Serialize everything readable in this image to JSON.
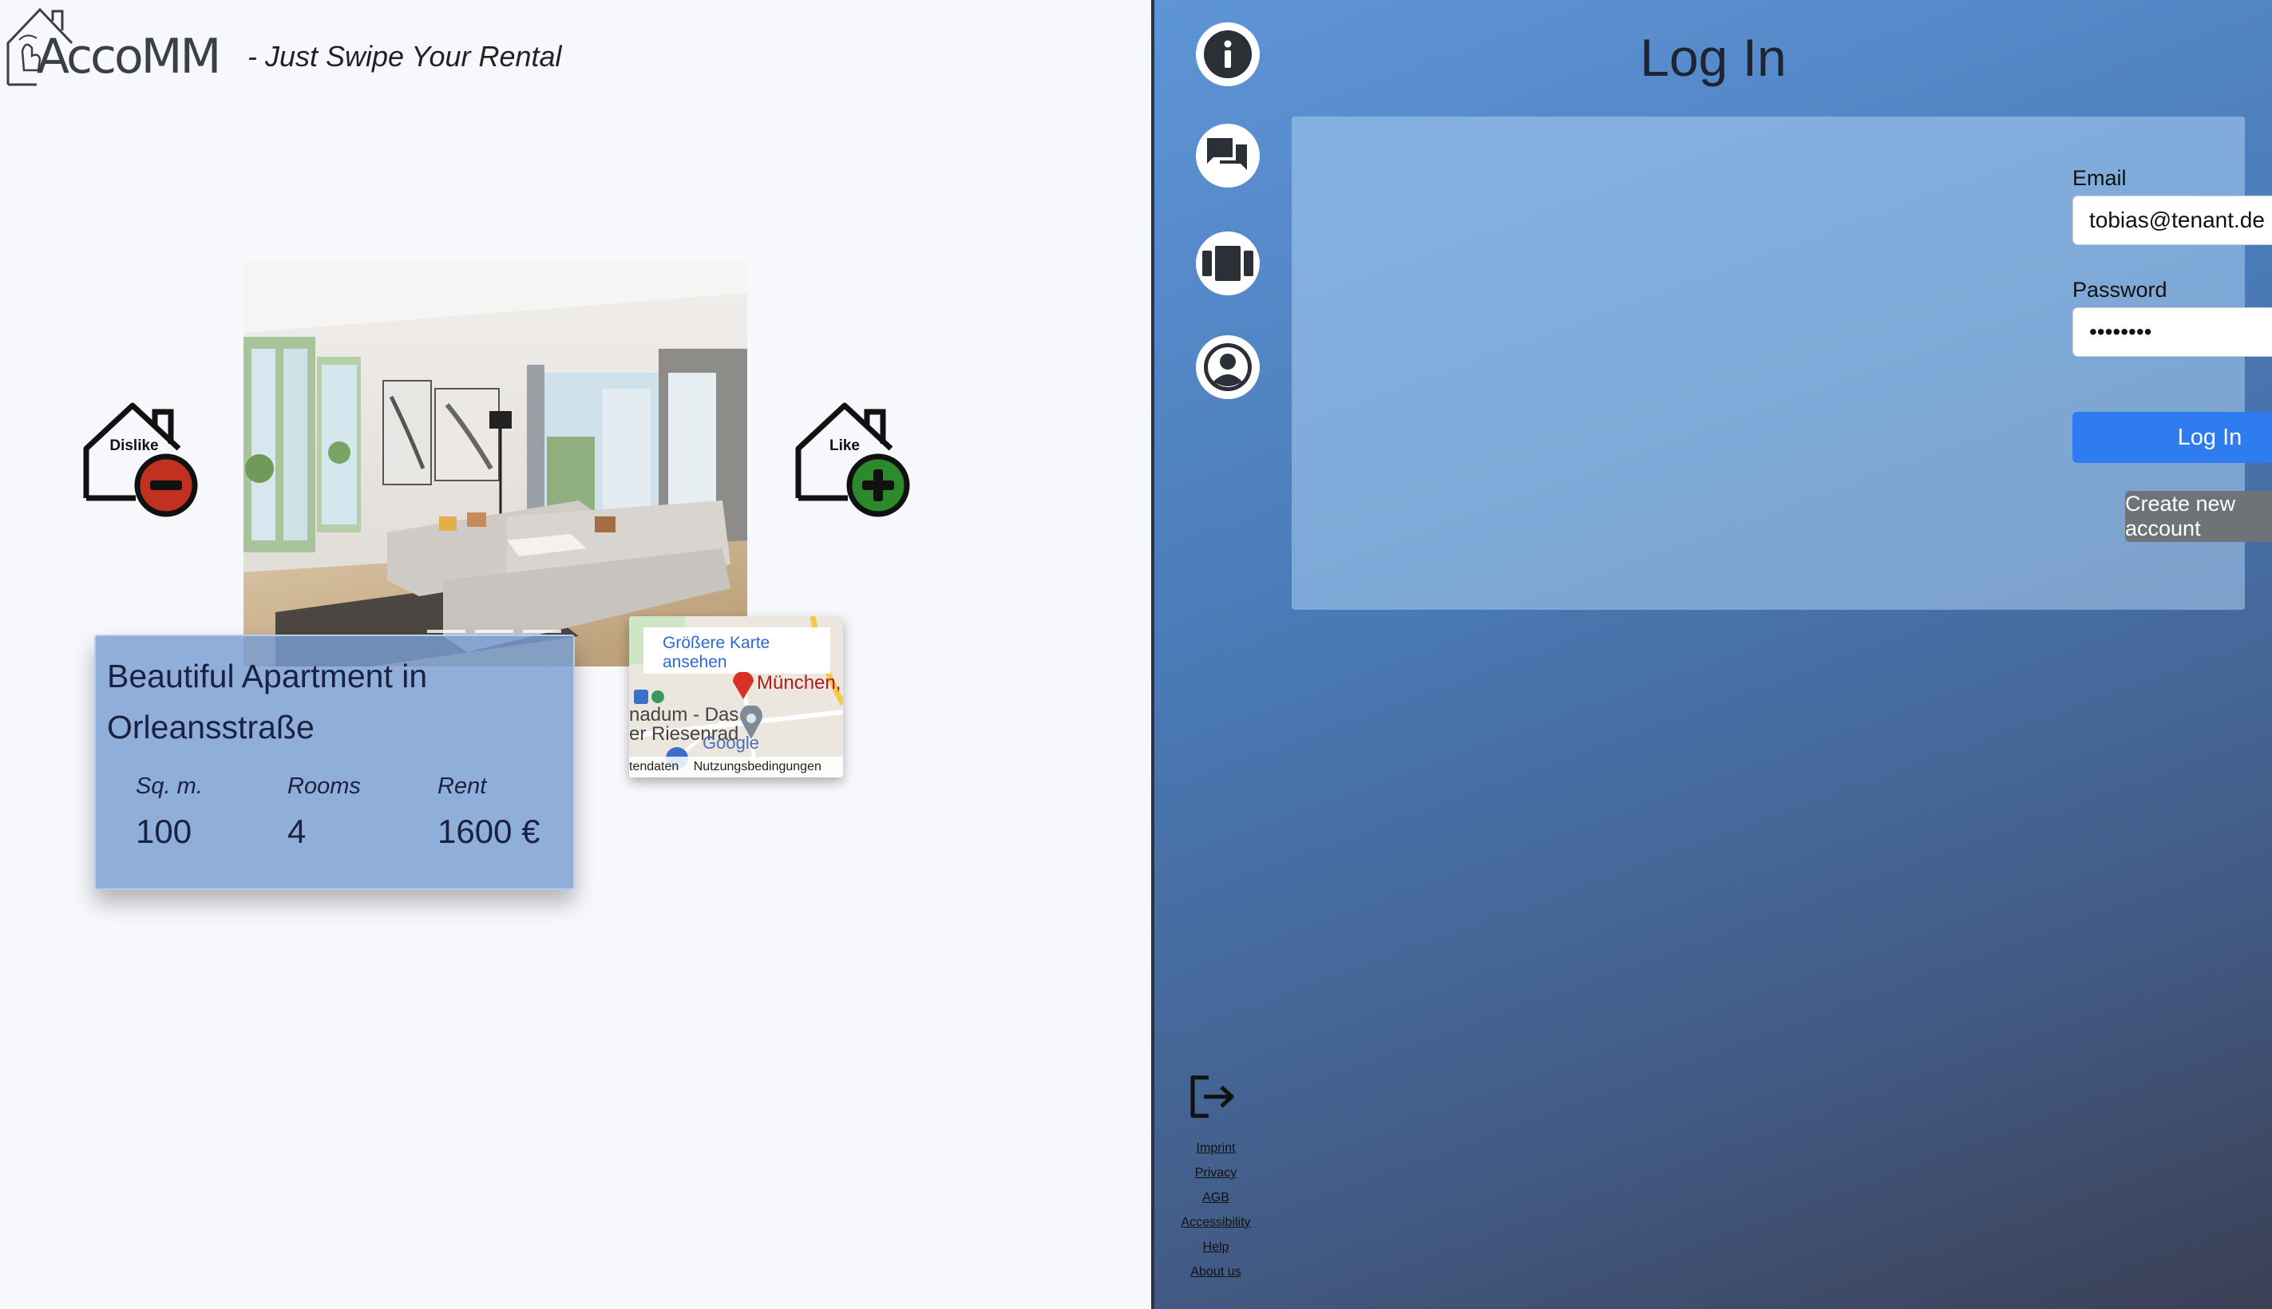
{
  "header": {
    "logo_text": "AccoMM",
    "tagline": "- Just Swipe Your Rental"
  },
  "actions": {
    "dislike_label": "Dislike",
    "like_label": "Like"
  },
  "listing": {
    "title": "Beautiful Apartment in Orleansstraße",
    "stats": [
      {
        "label": "Sq. m.",
        "value": "100"
      },
      {
        "label": "Rooms",
        "value": "4"
      },
      {
        "label": "Rent",
        "value": "1600 €"
      }
    ]
  },
  "map": {
    "larger_map_link": "Größere Karte ansehen",
    "place_text_1": "München,",
    "place_text_2": "nadum - Das",
    "place_text_3": "er Riesenrad",
    "brand": "Google",
    "footer_left": "tendaten",
    "footer_right": "Nutzungsbedingungen"
  },
  "nav": {
    "icons": [
      "info-icon",
      "chat-icon",
      "swipe-cards-icon",
      "profile-icon"
    ],
    "logout_icon": "logout-icon",
    "footer_links": [
      "Imprint",
      "Privacy",
      "AGB",
      "Accessibility",
      "Help",
      "About us"
    ]
  },
  "login": {
    "title": "Log In",
    "email_label": "Email",
    "email_value": "tobias@tenant.de",
    "password_label": "Password",
    "password_value": "••••••••",
    "login_button": "Log In",
    "create_account_button": "Create new account"
  },
  "colors": {
    "primary_button": "#2f7cf0",
    "secondary_button": "#6e7378",
    "dislike_red": "#c0311f",
    "like_green": "#2c8a2c"
  }
}
